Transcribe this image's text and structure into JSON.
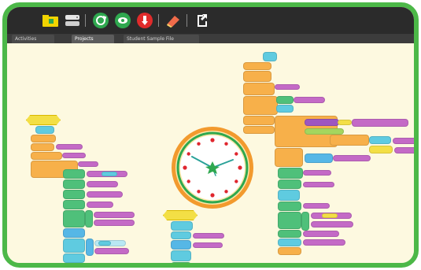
{
  "toolbar": {
    "buttons": [
      {
        "name": "folder-icon",
        "color": "#f2d400"
      },
      {
        "name": "drive-icon",
        "color": "#e6e6e6"
      },
      {
        "name": "run-icon",
        "color": "#2fa84f"
      },
      {
        "name": "view-icon",
        "color": "#2fa84f"
      },
      {
        "name": "stop-icon",
        "color": "#e02b2b"
      },
      {
        "name": "eraser-icon",
        "color": "#f06b4a"
      },
      {
        "name": "export-icon",
        "color": "#ffffff"
      }
    ]
  },
  "tabs": [
    {
      "label": "Activities",
      "active": false
    },
    {
      "label": "Projects",
      "active": true
    },
    {
      "label": "Student Sample File",
      "active": false
    }
  ],
  "colors": {
    "frame": "#4cb848",
    "canvas": "#fdf9e0",
    "clock_ring": "#f29a2e",
    "clock_inner_ring": "#2fa84f",
    "clock_marks": "#e0262e",
    "clock_hands": "#2aa198"
  }
}
